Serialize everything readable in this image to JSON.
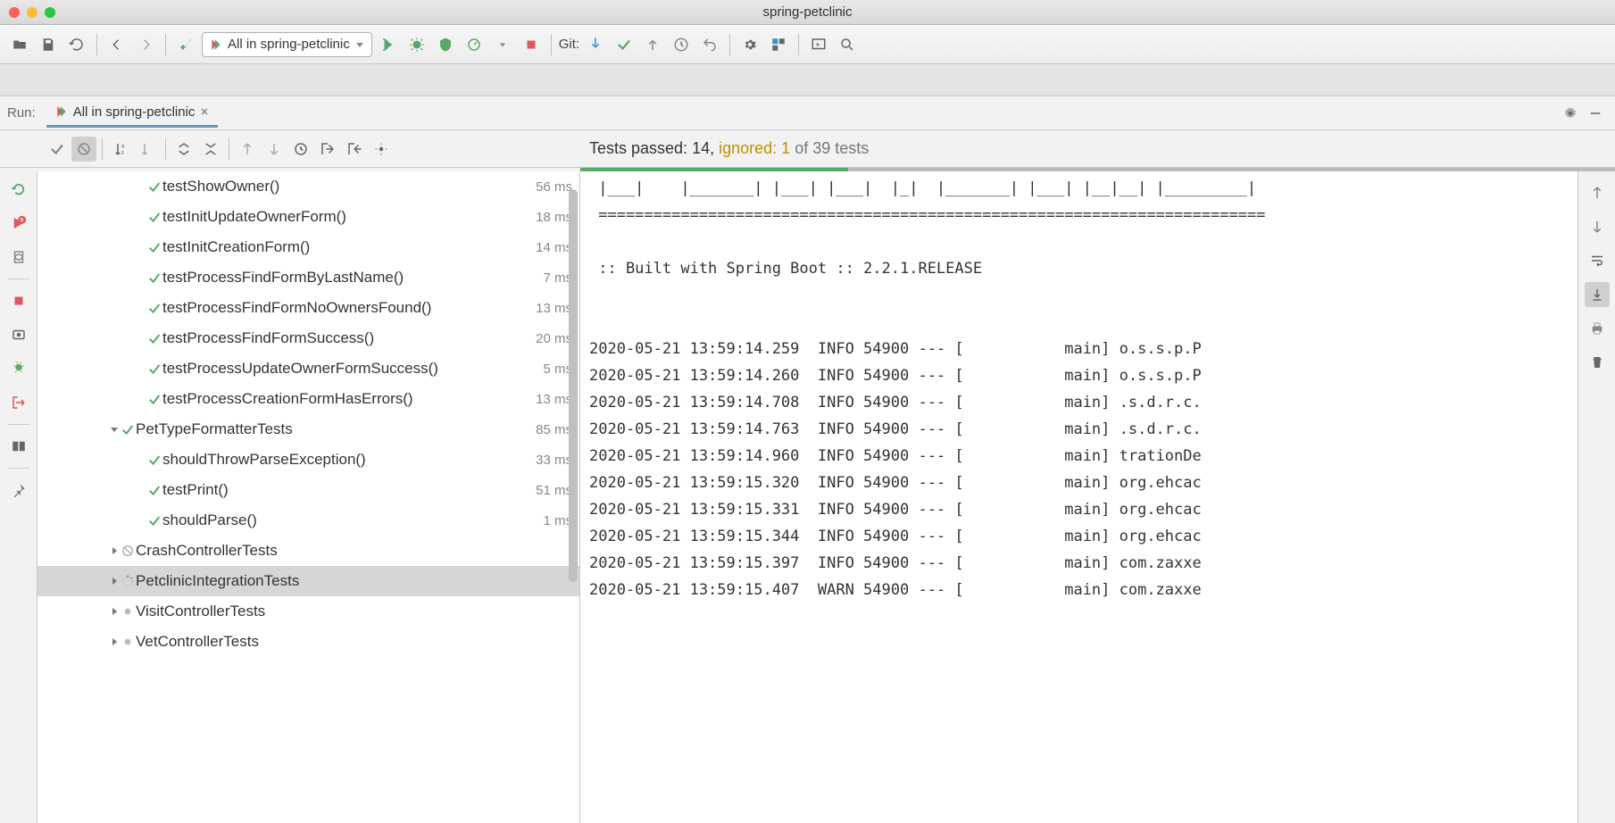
{
  "window": {
    "title": "spring-petclinic"
  },
  "toolbar": {
    "run_config": "All in spring-petclinic",
    "git_label": "Git:"
  },
  "run_panel": {
    "label": "Run:",
    "tab_label": "All in spring-petclinic"
  },
  "test_summary": {
    "prefix": "Tests passed: ",
    "passed": "14",
    "sep": ", ",
    "ignored_label": "ignored: ",
    "ignored": "1",
    "of_label": " of ",
    "total": "39",
    "suffix": " tests"
  },
  "tree": [
    {
      "indent": 3,
      "status": "passed",
      "name": "testShowOwner()",
      "time": "56 ms"
    },
    {
      "indent": 3,
      "status": "passed",
      "name": "testInitUpdateOwnerForm()",
      "time": "18 ms"
    },
    {
      "indent": 3,
      "status": "passed",
      "name": "testInitCreationForm()",
      "time": "14 ms"
    },
    {
      "indent": 3,
      "status": "passed",
      "name": "testProcessFindFormByLastName()",
      "time": "7 ms"
    },
    {
      "indent": 3,
      "status": "passed",
      "name": "testProcessFindFormNoOwnersFound()",
      "time": "13 ms"
    },
    {
      "indent": 3,
      "status": "passed",
      "name": "testProcessFindFormSuccess()",
      "time": "20 ms"
    },
    {
      "indent": 3,
      "status": "passed",
      "name": "testProcessUpdateOwnerFormSuccess()",
      "time": "5 ms"
    },
    {
      "indent": 3,
      "status": "passed",
      "name": "testProcessCreationFormHasErrors()",
      "time": "13 ms"
    },
    {
      "indent": 2,
      "status": "passed",
      "name": "PetTypeFormatterTests",
      "time": "85 ms",
      "arrow": "down"
    },
    {
      "indent": 3,
      "status": "passed",
      "name": "shouldThrowParseException()",
      "time": "33 ms"
    },
    {
      "indent": 3,
      "status": "passed",
      "name": "testPrint()",
      "time": "51 ms"
    },
    {
      "indent": 3,
      "status": "passed",
      "name": "shouldParse()",
      "time": "1 ms"
    },
    {
      "indent": 2,
      "status": "ignored",
      "name": "CrashControllerTests",
      "time": "",
      "arrow": "right"
    },
    {
      "indent": 2,
      "status": "running",
      "name": "PetclinicIntegrationTests",
      "time": "",
      "arrow": "right",
      "selected": true
    },
    {
      "indent": 2,
      "status": "pending",
      "name": "VisitControllerTests",
      "time": "",
      "arrow": "right"
    },
    {
      "indent": 2,
      "status": "pending",
      "name": "VetControllerTests",
      "time": "",
      "arrow": "right"
    }
  ],
  "console": {
    "lines": [
      " |___|    |_______| |___| |___|  |_|  |_______| |___| |__|__| |_________|",
      " =========================================================================",
      "",
      " :: Built with Spring Boot :: 2.2.1.RELEASE",
      "",
      "",
      "2020-05-21 13:59:14.259  INFO 54900 --- [           main] o.s.s.p.P",
      "2020-05-21 13:59:14.260  INFO 54900 --- [           main] o.s.s.p.P",
      "2020-05-21 13:59:14.708  INFO 54900 --- [           main] .s.d.r.c.",
      "2020-05-21 13:59:14.763  INFO 54900 --- [           main] .s.d.r.c.",
      "2020-05-21 13:59:14.960  INFO 54900 --- [           main] trationDe",
      "2020-05-21 13:59:15.320  INFO 54900 --- [           main] org.ehcac",
      "2020-05-21 13:59:15.331  INFO 54900 --- [           main] org.ehcac",
      "2020-05-21 13:59:15.344  INFO 54900 --- [           main] org.ehcac",
      "2020-05-21 13:59:15.397  INFO 54900 --- [           main] com.zaxxe",
      "2020-05-21 13:59:15.407  WARN 54900 --- [           main] com.zaxxe"
    ]
  }
}
